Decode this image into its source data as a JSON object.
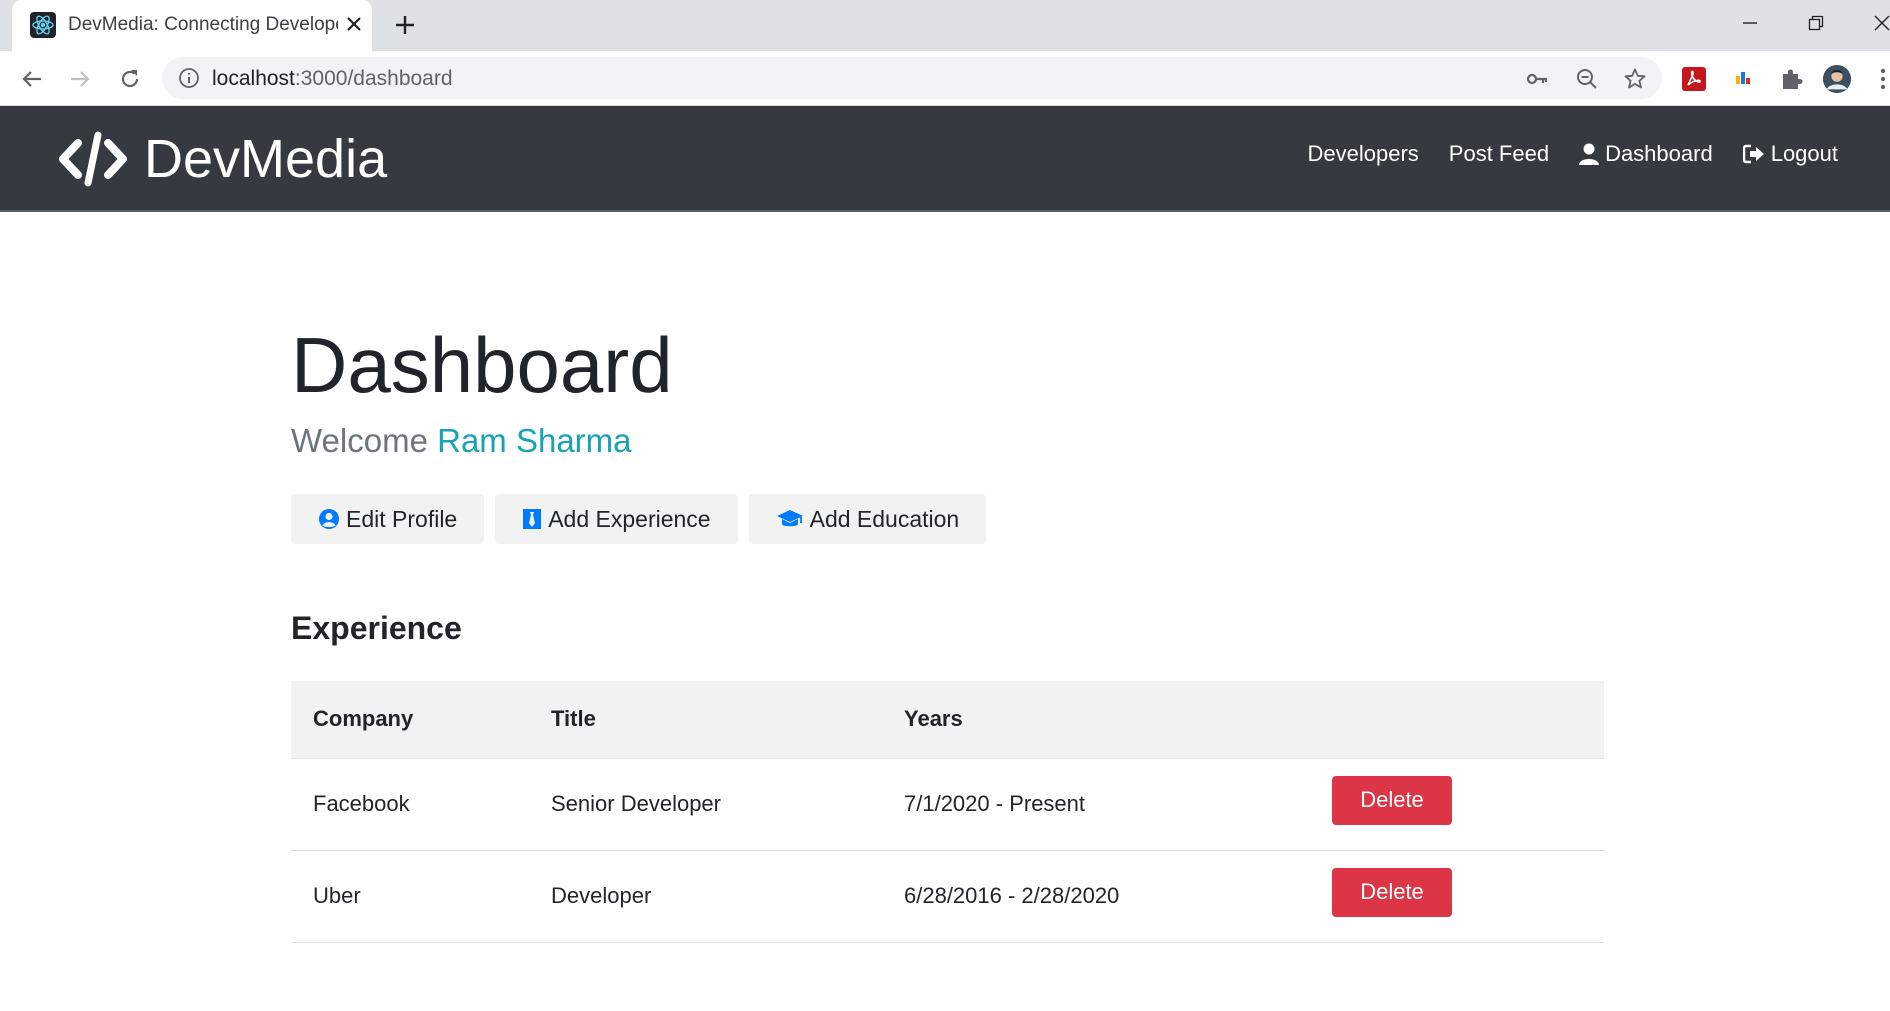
{
  "browser": {
    "tab_title": "DevMedia: Connecting Developers",
    "url_host": "localhost",
    "url_rest": ":3000/dashboard"
  },
  "navbar": {
    "brand": "DevMedia",
    "links": [
      {
        "label": "Developers",
        "icon": ""
      },
      {
        "label": "Post Feed",
        "icon": ""
      },
      {
        "label": "Dashboard",
        "icon": "user-icon"
      },
      {
        "label": "Logout",
        "icon": "logout-icon"
      }
    ]
  },
  "dashboard": {
    "title": "Dashboard",
    "welcome_prefix": "Welcome",
    "user_name": "Ram Sharma",
    "actions": [
      {
        "label": "Edit Profile",
        "icon": "user-circle-icon"
      },
      {
        "label": "Add Experience",
        "icon": "black-tie-icon"
      },
      {
        "label": "Add Education",
        "icon": "graduation-cap-icon"
      }
    ]
  },
  "experience": {
    "section_title": "Experience",
    "columns": [
      "Company",
      "Title",
      "Years",
      ""
    ],
    "rows": [
      {
        "company": "Facebook",
        "title": "Senior Developer",
        "years": "7/1/2020 - Present",
        "action": "Delete"
      },
      {
        "company": "Uber",
        "title": "Developer",
        "years": "6/28/2016 - 2/28/2020",
        "action": "Delete"
      }
    ]
  },
  "colors": {
    "navbar_bg": "#343a40",
    "accent_info": "#17a2b8",
    "danger": "#dc3545",
    "icon_blue": "#007bff"
  }
}
